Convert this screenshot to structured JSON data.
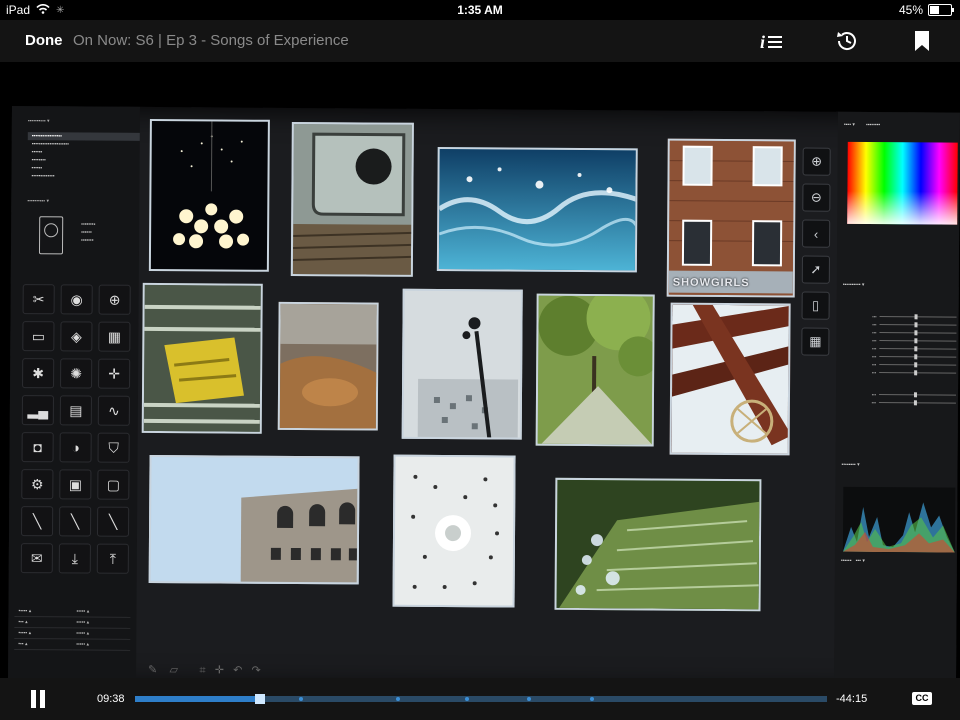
{
  "status_bar": {
    "device": "iPad",
    "time": "1:35 AM",
    "battery": "45%",
    "battery_level": 0.45
  },
  "top_bar": {
    "done_label": "Done",
    "now_playing": "On Now: S6 | Ep 3 - Songs of Experience",
    "icons": [
      "info-list-icon",
      "history-icon",
      "bookmark-icon"
    ]
  },
  "video_frame": {
    "photos": [
      {
        "name": "chandelier"
      },
      {
        "name": "stone-hole"
      },
      {
        "name": "water-splash"
      },
      {
        "name": "showgirls-building",
        "sign": "SHOWGIRLS"
      },
      {
        "name": "yellow-chair"
      },
      {
        "name": "rusty-metal"
      },
      {
        "name": "lamppost"
      },
      {
        "name": "tree-path"
      },
      {
        "name": "wooden-beams"
      },
      {
        "name": "building-corner"
      },
      {
        "name": "dandelion"
      },
      {
        "name": "green-fountain"
      }
    ]
  },
  "playback": {
    "elapsed": "09:38",
    "remaining": "-44:15",
    "progress": 0.18,
    "cc_label": "CC",
    "chapter_markers": [
      0.24,
      0.38,
      0.48,
      0.57,
      0.66
    ]
  },
  "colors": {
    "accent": "#2e7ec9",
    "track": "#2a4a66",
    "bar_bg": "#141414"
  }
}
